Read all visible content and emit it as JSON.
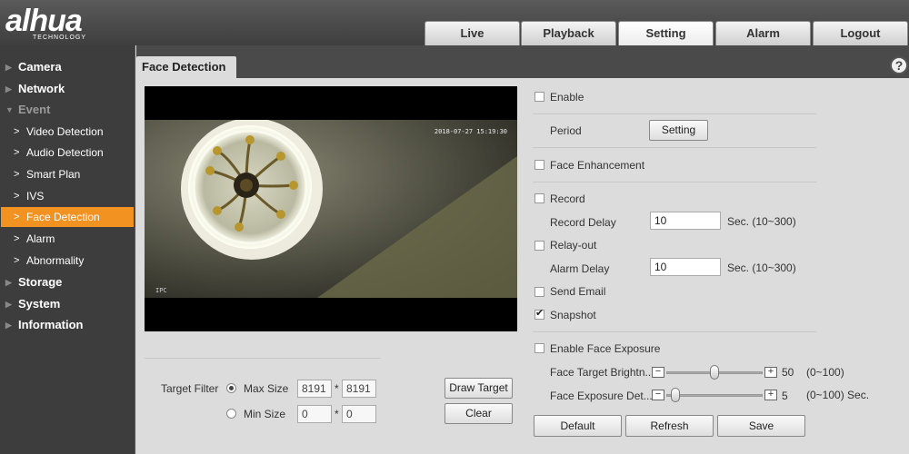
{
  "brand": {
    "name": "alhua",
    "tagline": "TECHNOLOGY"
  },
  "nav": [
    "Live",
    "Playback",
    "Setting",
    "Alarm",
    "Logout"
  ],
  "nav_active": "Setting",
  "sidebar": {
    "sections": [
      "Camera",
      "Network",
      "Event",
      "Storage",
      "System",
      "Information"
    ],
    "event_items": [
      "Video Detection",
      "Audio Detection",
      "Smart Plan",
      "IVS",
      "Face Detection",
      "Alarm",
      "Abnormality"
    ],
    "active_item": "Face Detection"
  },
  "page": {
    "title": "Face Detection",
    "help": "?"
  },
  "video": {
    "timestamp": "2018-07-27 15:19:30",
    "channel": "IPC"
  },
  "target_filter": {
    "label": "Target Filter",
    "max_label": "Max Size",
    "max_w": "8191",
    "max_h": "8191",
    "min_label": "Min Size",
    "min_w": "0",
    "min_h": "0",
    "separator": "*",
    "selected": "Max Size",
    "draw_button": "Draw Target",
    "clear_button": "Clear"
  },
  "form": {
    "enable": {
      "label": "Enable",
      "checked": false
    },
    "period": {
      "label": "Period",
      "button": "Setting"
    },
    "face_enhancement": {
      "label": "Face Enhancement",
      "checked": false
    },
    "record": {
      "label": "Record",
      "checked": false
    },
    "record_delay": {
      "label": "Record Delay",
      "value": "10",
      "unit": "Sec. (10~300)"
    },
    "relay_out": {
      "label": "Relay-out",
      "checked": false
    },
    "alarm_delay": {
      "label": "Alarm Delay",
      "value": "10",
      "unit": "Sec. (10~300)"
    },
    "send_email": {
      "label": "Send Email",
      "checked": false
    },
    "snapshot": {
      "label": "Snapshot",
      "checked": true
    },
    "face_exposure": {
      "label": "Enable Face Exposure",
      "checked": false
    },
    "target_brightness": {
      "label": "Face Target Brightn...",
      "value": "50",
      "range": "(0~100)",
      "level": 0.5
    },
    "exposure_duration": {
      "label": "Face Exposure Det...",
      "value": "5",
      "range": "(0~100) Sec.",
      "level": 0.05
    }
  },
  "buttons": {
    "default": "Default",
    "refresh": "Refresh",
    "save": "Save"
  },
  "colors": {
    "accent": "#f29221",
    "sidebar_bg": "#3d3d3d",
    "header_bg": "#4a4a4a",
    "panel_bg": "#dcdcdc"
  }
}
